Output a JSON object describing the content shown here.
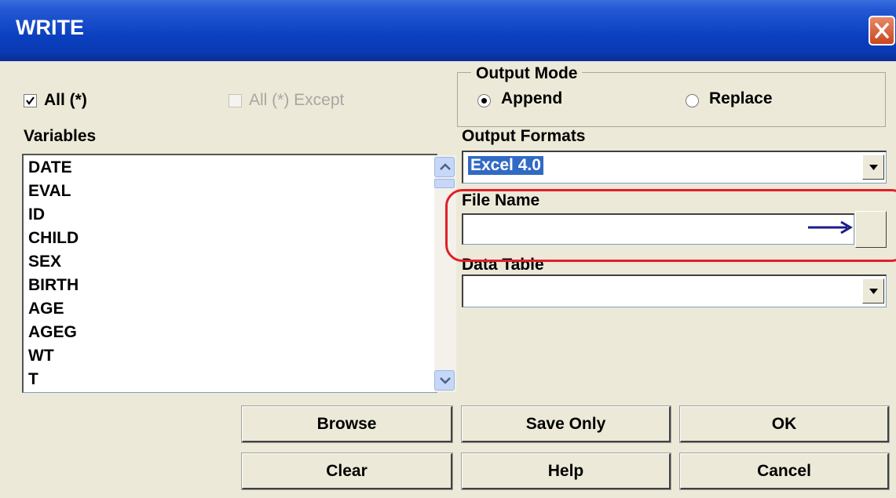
{
  "title": "WRITE",
  "options": {
    "all": {
      "label": "All (*)",
      "checked": true
    },
    "all_except": {
      "label": "All (*) Except",
      "checked": false,
      "disabled": true
    }
  },
  "variables": {
    "label": "Variables",
    "items": [
      "DATE",
      "EVAL",
      "ID",
      "CHILD",
      "SEX",
      "BIRTH",
      "AGE",
      "AGEG",
      "WT",
      "T"
    ]
  },
  "output_mode": {
    "label": "Output Mode",
    "append_label": "Append",
    "replace_label": "Replace",
    "selected": "Append"
  },
  "output_formats": {
    "label": "Output Formats",
    "value": "Excel 4.0"
  },
  "file_name": {
    "label": "File Name",
    "value": ""
  },
  "data_table": {
    "label": "Data Table",
    "value": ""
  },
  "buttons": {
    "browse": "Browse",
    "save_only": "Save Only",
    "ok": "OK",
    "clear": "Clear",
    "help": "Help",
    "cancel": "Cancel"
  },
  "colors": {
    "titlebar": "#0A3FBF",
    "dialog_bg": "#ECE9D8",
    "selection": "#316AC5",
    "annotation": "#E0202A",
    "arrow": "#1A1A8C"
  },
  "icons": [
    "close-icon",
    "check-icon",
    "scroll-up-icon",
    "scroll-down-icon",
    "dropdown-arrow-icon",
    "arrow-right-icon"
  ]
}
